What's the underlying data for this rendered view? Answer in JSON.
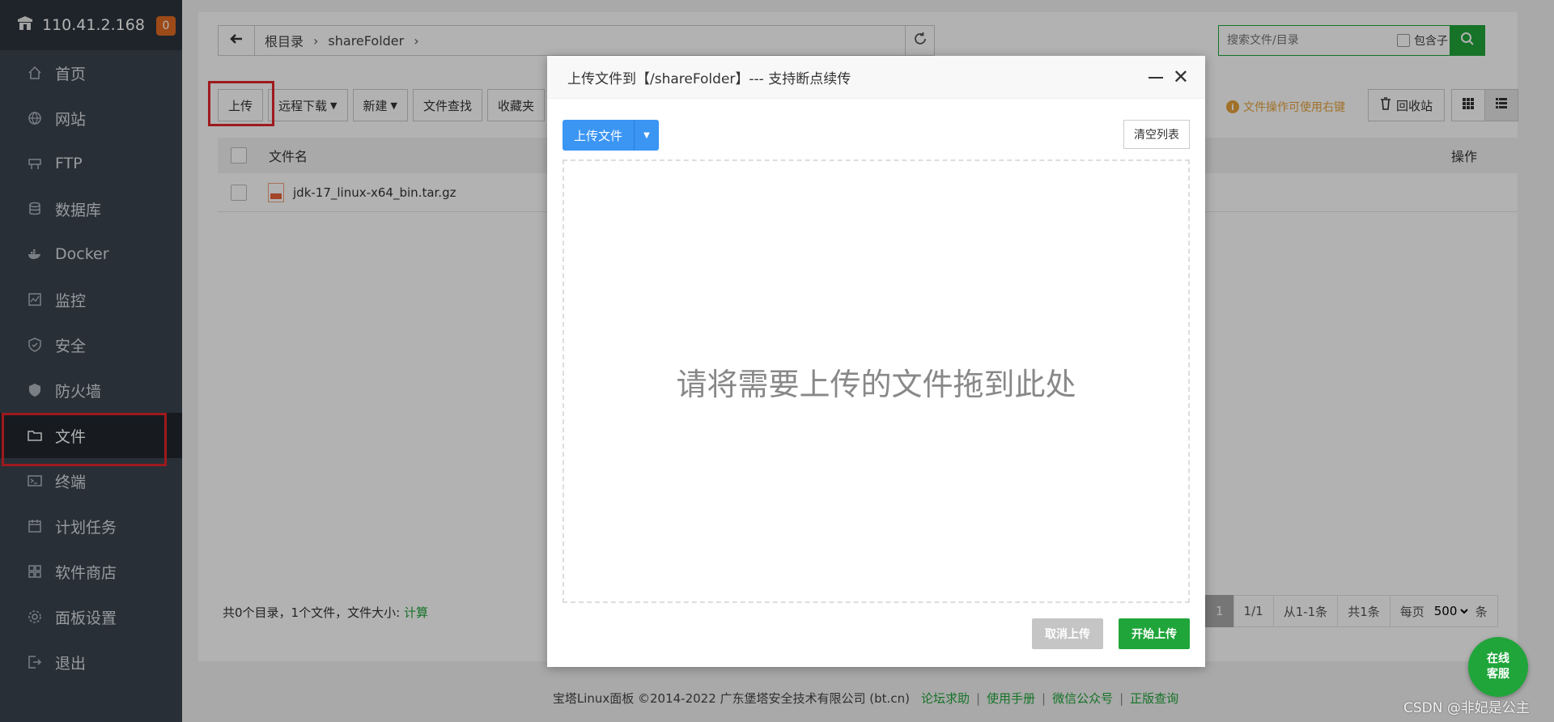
{
  "sidebar": {
    "server_ip": "110.41.2.168",
    "notice_count": "0",
    "items": [
      {
        "label": "首页",
        "icon": "home-icon"
      },
      {
        "label": "网站",
        "icon": "globe-icon"
      },
      {
        "label": "FTP",
        "icon": "ftp-icon"
      },
      {
        "label": "数据库",
        "icon": "database-icon"
      },
      {
        "label": "Docker",
        "icon": "docker-icon"
      },
      {
        "label": "监控",
        "icon": "monitor-icon"
      },
      {
        "label": "安全",
        "icon": "shield-icon"
      },
      {
        "label": "防火墙",
        "icon": "firewall-icon"
      },
      {
        "label": "文件",
        "icon": "folder-icon"
      },
      {
        "label": "终端",
        "icon": "terminal-icon"
      },
      {
        "label": "计划任务",
        "icon": "calendar-icon"
      },
      {
        "label": "软件商店",
        "icon": "grid-icon"
      },
      {
        "label": "面板设置",
        "icon": "gear-icon"
      },
      {
        "label": "退出",
        "icon": "logout-icon"
      }
    ],
    "active_item": "文件"
  },
  "path": {
    "root": "根目录",
    "folder": "shareFolder"
  },
  "search": {
    "placeholder": "搜索文件/目录",
    "include_subdir_label": "包含子目录"
  },
  "toolbar": {
    "upload": "上传",
    "remote_download": "远程下载",
    "new": "新建",
    "file_search": "文件查找",
    "favorites": "收藏夹"
  },
  "right_tools": {
    "tip": "文件操作可使用右键",
    "recycle": "回收站"
  },
  "table": {
    "col_name": "文件名",
    "col_ops": "操作",
    "rows": [
      {
        "name": "jdk-17_linux-x64_bin.tar.gz"
      }
    ]
  },
  "summary": {
    "text": "共0个目录，1个文件，文件大小:",
    "calc_link": "计算"
  },
  "pager": {
    "current": "1",
    "pages": "1/1",
    "range": "从1-1条",
    "total": "共1条",
    "per_page_label": "每页",
    "per_page_value": "500",
    "unit": "条"
  },
  "modal": {
    "title": "上传文件到【/shareFolder】--- 支持断点续传",
    "upload_file_btn": "上传文件",
    "clear_list_btn": "清空列表",
    "drop_hint": "请将需要上传的文件拖到此处",
    "cancel_btn": "取消上传",
    "start_btn": "开始上传"
  },
  "footer": {
    "copyright": "宝塔Linux面板 ©2014-2022 广东堡塔安全技术有限公司 (bt.cn)",
    "links": [
      "论坛求助",
      "使用手册",
      "微信公众号",
      "正版查询"
    ]
  },
  "online_service": {
    "line1": "在线",
    "line2": "客服"
  },
  "watermark": "CSDN @非妃是公主",
  "colors": {
    "sidebar_bg": "#3a4450",
    "accent_green": "#20a53a",
    "upload_blue": "#3b95f3",
    "highlight_red": "#e3262c",
    "badge_orange": "#e06a22"
  }
}
